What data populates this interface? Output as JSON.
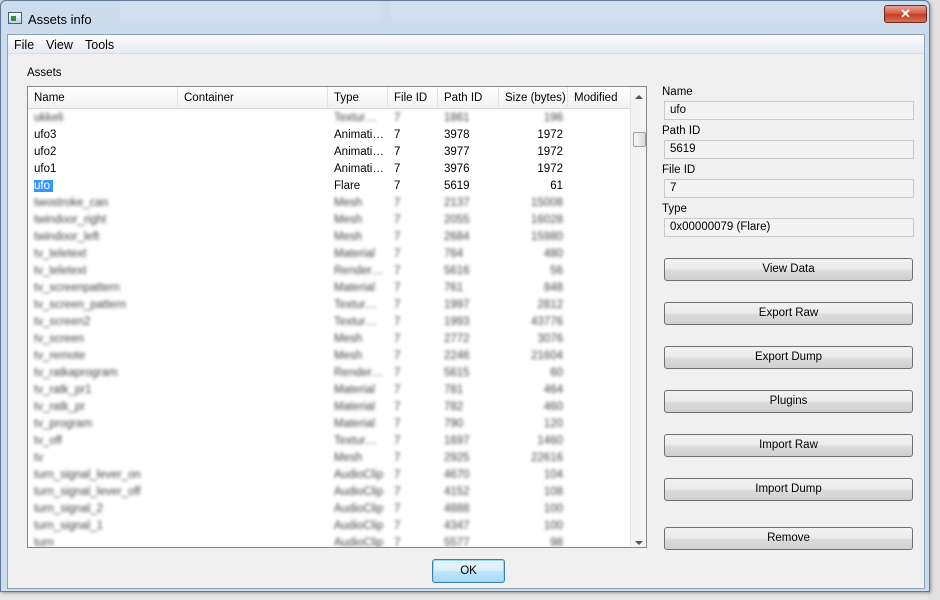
{
  "window": {
    "title": "Assets info",
    "close_glyph": "✕"
  },
  "menu": [
    "File",
    "View",
    "Tools"
  ],
  "assets_label": "Assets",
  "columns": [
    "Name",
    "Container",
    "Type",
    "File ID",
    "Path ID",
    "Size (bytes)",
    "Modified"
  ],
  "rows": [
    {
      "name": "ukkeli",
      "type": "Textur…",
      "file_id": "7",
      "path_id": "1861",
      "size": "196",
      "blur": true
    },
    {
      "name": "ufo3",
      "type": "Animati…",
      "file_id": "7",
      "path_id": "3978",
      "size": "1972",
      "blur": false
    },
    {
      "name": "ufo2",
      "type": "Animati…",
      "file_id": "7",
      "path_id": "3977",
      "size": "1972",
      "blur": false
    },
    {
      "name": "ufo1",
      "type": "Animati…",
      "file_id": "7",
      "path_id": "3976",
      "size": "1972",
      "blur": false
    },
    {
      "name": "ufo",
      "type": "Flare",
      "file_id": "7",
      "path_id": "5619",
      "size": "61",
      "blur": false,
      "selected": true
    },
    {
      "name": "twostroke_can",
      "type": "Mesh",
      "file_id": "7",
      "path_id": "2137",
      "size": "15008",
      "blur": true
    },
    {
      "name": "twindoor_right",
      "type": "Mesh",
      "file_id": "7",
      "path_id": "2055",
      "size": "16028",
      "blur": true
    },
    {
      "name": "twindoor_left",
      "type": "Mesh",
      "file_id": "7",
      "path_id": "2684",
      "size": "15980",
      "blur": true
    },
    {
      "name": "tv_teletext",
      "type": "Material",
      "file_id": "7",
      "path_id": "764",
      "size": "480",
      "blur": true
    },
    {
      "name": "tv_teletext",
      "type": "Render…",
      "file_id": "7",
      "path_id": "5616",
      "size": "56",
      "blur": true
    },
    {
      "name": "tv_screenpattern",
      "type": "Material",
      "file_id": "7",
      "path_id": "761",
      "size": "848",
      "blur": true
    },
    {
      "name": "tv_screen_pattern",
      "type": "Textur…",
      "file_id": "7",
      "path_id": "1997",
      "size": "2812",
      "blur": true
    },
    {
      "name": "tv_screen2",
      "type": "Textur…",
      "file_id": "7",
      "path_id": "1993",
      "size": "43776",
      "blur": true
    },
    {
      "name": "tv_screen",
      "type": "Mesh",
      "file_id": "7",
      "path_id": "2772",
      "size": "3076",
      "blur": true
    },
    {
      "name": "tv_remote",
      "type": "Mesh",
      "file_id": "7",
      "path_id": "2246",
      "size": "21604",
      "blur": true
    },
    {
      "name": "tv_ratkaprogram",
      "type": "Render…",
      "file_id": "7",
      "path_id": "5615",
      "size": "60",
      "blur": true
    },
    {
      "name": "tv_ratk_pr1",
      "type": "Material",
      "file_id": "7",
      "path_id": "781",
      "size": "464",
      "blur": true
    },
    {
      "name": "tv_ratk_pr",
      "type": "Material",
      "file_id": "7",
      "path_id": "782",
      "size": "460",
      "blur": true
    },
    {
      "name": "tv_program",
      "type": "Material",
      "file_id": "7",
      "path_id": "790",
      "size": "120",
      "blur": true
    },
    {
      "name": "tv_off",
      "type": "Textur…",
      "file_id": "7",
      "path_id": "1697",
      "size": "1460",
      "blur": true
    },
    {
      "name": "tv",
      "type": "Mesh",
      "file_id": "7",
      "path_id": "2925",
      "size": "22616",
      "blur": true
    },
    {
      "name": "turn_signal_lever_on",
      "type": "AudioClip",
      "file_id": "7",
      "path_id": "4670",
      "size": "104",
      "blur": true
    },
    {
      "name": "turn_signal_lever_off",
      "type": "AudioClip",
      "file_id": "7",
      "path_id": "4152",
      "size": "108",
      "blur": true
    },
    {
      "name": "turn_signal_2",
      "type": "AudioClip",
      "file_id": "7",
      "path_id": "4888",
      "size": "100",
      "blur": true
    },
    {
      "name": "turn_signal_1",
      "type": "AudioClip",
      "file_id": "7",
      "path_id": "4347",
      "size": "100",
      "blur": true
    },
    {
      "name": "turn",
      "type": "AudioClip",
      "file_id": "7",
      "path_id": "5577",
      "size": "98",
      "blur": true
    }
  ],
  "details": {
    "name_label": "Name",
    "name_value": "ufo",
    "path_label": "Path ID",
    "path_value": "5619",
    "file_label": "File ID",
    "file_value": "7",
    "type_label": "Type",
    "type_value": "0x00000079 (Flare)"
  },
  "buttons": {
    "view_data": "View Data",
    "export_raw": "Export Raw",
    "export_dump": "Export Dump",
    "plugins": "Plugins",
    "import_raw": "Import Raw",
    "import_dump": "Import Dump",
    "remove": "Remove",
    "ok": "OK"
  },
  "icons": [
    "app-window-icon",
    "close-icon",
    "scroll-up-arrow-icon",
    "scroll-down-arrow-icon"
  ]
}
